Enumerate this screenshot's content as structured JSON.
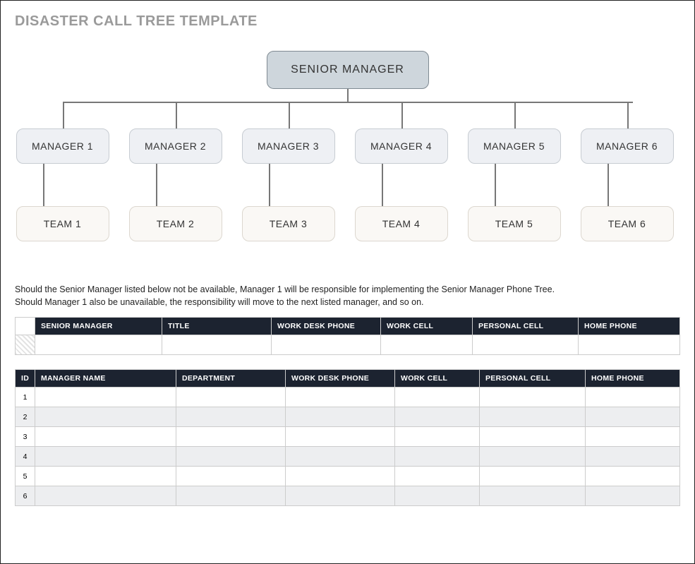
{
  "title": "DISASTER CALL TREE TEMPLATE",
  "org": {
    "senior": "SENIOR MANAGER",
    "managers": [
      "MANAGER 1",
      "MANAGER 2",
      "MANAGER 3",
      "MANAGER 4",
      "MANAGER 5",
      "MANAGER 6"
    ],
    "teams": [
      "TEAM 1",
      "TEAM 2",
      "TEAM 3",
      "TEAM 4",
      "TEAM 5",
      "TEAM 6"
    ]
  },
  "desc": {
    "line1": "Should the Senior Manager listed below not be available, Manager 1 will be responsible for implementing the Senior Manager Phone Tree.",
    "line2": "Should Manager 1 also be unavailable, the responsibility will move to the next listed manager, and so on."
  },
  "table1": {
    "headers": [
      "SENIOR MANAGER",
      "TITLE",
      "WORK DESK PHONE",
      "WORK CELL",
      "PERSONAL CELL",
      "HOME PHONE"
    ],
    "row": [
      "",
      "",
      "",
      "",
      "",
      ""
    ]
  },
  "table2": {
    "headers": [
      "ID",
      "MANAGER NAME",
      "DEPARTMENT",
      "WORK DESK PHONE",
      "WORK CELL",
      "PERSONAL CELL",
      "HOME PHONE"
    ],
    "rows": [
      {
        "id": "1",
        "cells": [
          "",
          "",
          "",
          "",
          "",
          ""
        ]
      },
      {
        "id": "2",
        "cells": [
          "",
          "",
          "",
          "",
          "",
          ""
        ]
      },
      {
        "id": "3",
        "cells": [
          "",
          "",
          "",
          "",
          "",
          ""
        ]
      },
      {
        "id": "4",
        "cells": [
          "",
          "",
          "",
          "",
          "",
          ""
        ]
      },
      {
        "id": "5",
        "cells": [
          "",
          "",
          "",
          "",
          "",
          ""
        ]
      },
      {
        "id": "6",
        "cells": [
          "",
          "",
          "",
          "",
          "",
          ""
        ]
      }
    ]
  }
}
